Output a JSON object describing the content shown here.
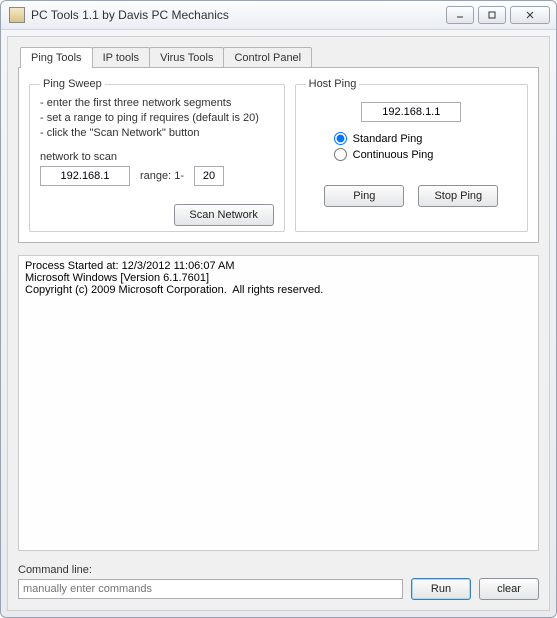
{
  "window": {
    "title": "PC Tools 1.1 by Davis PC Mechanics"
  },
  "tabs": [
    {
      "label": "Ping Tools"
    },
    {
      "label": "IP tools"
    },
    {
      "label": "Virus Tools"
    },
    {
      "label": "Control Panel"
    }
  ],
  "ping_sweep": {
    "legend": "Ping Sweep",
    "line1": "- enter the first three network segments",
    "line2": "- set a range to ping if requires (default is 20)",
    "line3": "- click the \"Scan Network\" button",
    "network_label": "network to scan",
    "network_value": "192.168.1",
    "range_label": "range:  1-",
    "range_value": "20",
    "scan_label": "Scan Network"
  },
  "host_ping": {
    "legend": "Host Ping",
    "ip_value": "192.168.1.1",
    "standard_label": "Standard Ping",
    "continuous_label": "Continuous Ping",
    "ping_label": "Ping",
    "stop_label": "Stop Ping"
  },
  "output": {
    "text": "Process Started at: 12/3/2012 11:06:07 AM\nMicrosoft Windows [Version 6.1.7601]\nCopyright (c) 2009 Microsoft Corporation.  All rights reserved."
  },
  "command": {
    "label": "Command line:",
    "placeholder": "manually enter commands",
    "run_label": "Run",
    "clear_label": "clear"
  },
  "win_controls": {
    "min": "—",
    "max": "▣",
    "close": "✕"
  }
}
